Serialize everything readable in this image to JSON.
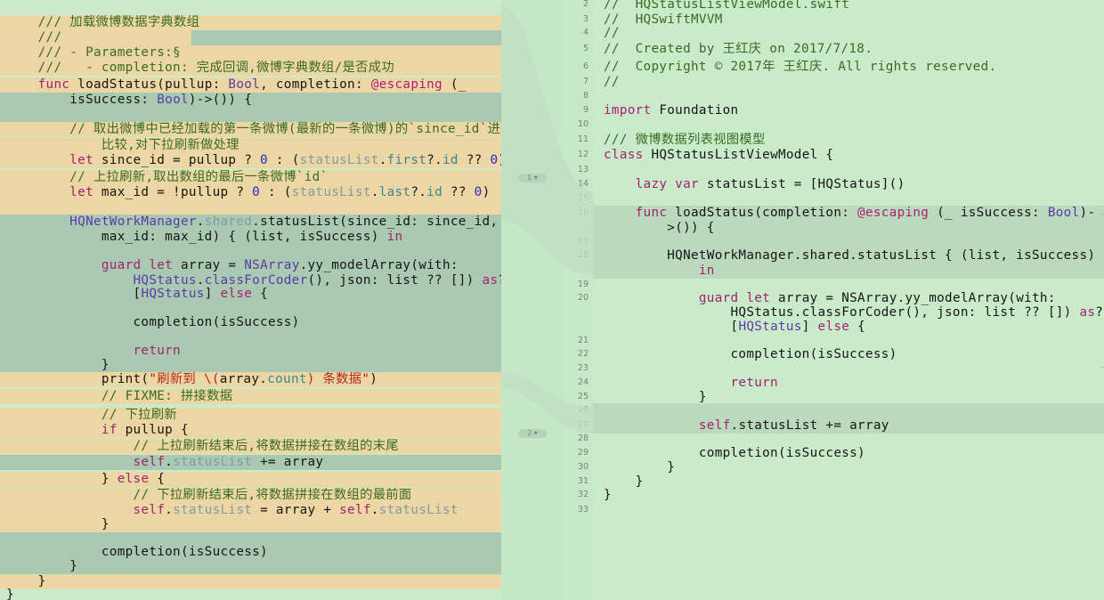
{
  "left_pane": {
    "lines": [
      {
        "bg": "y",
        "tokens": [
          {
            "c": "cm",
            "t": "    /// 加载微博数据字典数组"
          }
        ]
      },
      {
        "bg": "mix",
        "tokens": [
          {
            "c": "cm",
            "t": "    ///"
          }
        ]
      },
      {
        "bg": "y",
        "tokens": [
          {
            "c": "cm",
            "t": "    /// - Parameters:§"
          }
        ]
      },
      {
        "bg": "y",
        "tokens": [
          {
            "c": "cm",
            "t": "    ///   - completion: 完成回调,微博字典数组/是否成功"
          }
        ]
      },
      {
        "bg": "y",
        "tokens": [
          {
            "c": "kw",
            "t": "    func"
          },
          {
            "c": "pl",
            "t": " loadStatus(pullup: "
          },
          {
            "c": "ty",
            "t": "Bool"
          },
          {
            "c": "pl",
            "t": ", completion: "
          },
          {
            "c": "at",
            "t": "@escaping"
          },
          {
            "c": "pl",
            "t": " (_"
          }
        ]
      },
      {
        "bg": "g",
        "tokens": [
          {
            "c": "pl",
            "t": "        isSuccess: "
          },
          {
            "c": "ty",
            "t": "Bool"
          },
          {
            "c": "pl",
            "t": ")->()) {"
          }
        ]
      },
      {
        "bg": "g",
        "tokens": [
          {
            "c": "pl",
            "t": ""
          }
        ]
      },
      {
        "bg": "y",
        "tokens": [
          {
            "c": "cm",
            "t": "        // 取出微博中已经加载的第一条微博(最新的一条微博)的`since_id`进行"
          }
        ]
      },
      {
        "bg": "y",
        "tokens": [
          {
            "c": "cm",
            "t": "            比较,对下拉刷新做处理"
          }
        ]
      },
      {
        "bg": "y",
        "tokens": [
          {
            "c": "kw",
            "t": "        let"
          },
          {
            "c": "pl",
            "t": " since_id = pullup ? "
          },
          {
            "c": "num",
            "t": "0"
          },
          {
            "c": "pl",
            "t": " : ("
          },
          {
            "c": "gty",
            "t": "statusList"
          },
          {
            "c": "pl",
            "t": "."
          },
          {
            "c": "prop",
            "t": "first"
          },
          {
            "c": "pl",
            "t": "?."
          },
          {
            "c": "prop",
            "t": "id"
          },
          {
            "c": "pl",
            "t": " ?? "
          },
          {
            "c": "num",
            "t": "0"
          },
          {
            "c": "pl",
            "t": ")"
          }
        ]
      },
      {
        "bg": "y",
        "tokens": [
          {
            "c": "cm",
            "t": "        // 上拉刷新,取出数组的最后一条微博`id`"
          }
        ]
      },
      {
        "bg": "y",
        "tokens": [
          {
            "c": "kw",
            "t": "        let"
          },
          {
            "c": "pl",
            "t": " max_id = !pullup ? "
          },
          {
            "c": "num",
            "t": "0"
          },
          {
            "c": "pl",
            "t": " : ("
          },
          {
            "c": "gty",
            "t": "statusList"
          },
          {
            "c": "pl",
            "t": "."
          },
          {
            "c": "prop",
            "t": "last"
          },
          {
            "c": "pl",
            "t": "?."
          },
          {
            "c": "prop",
            "t": "id"
          },
          {
            "c": "pl",
            "t": " ?? "
          },
          {
            "c": "num",
            "t": "0"
          },
          {
            "c": "pl",
            "t": ")"
          }
        ]
      },
      {
        "bg": "y",
        "tokens": [
          {
            "c": "pl",
            "t": ""
          }
        ]
      },
      {
        "bg": "g",
        "tokens": [
          {
            "c": "ty",
            "t": "        HQNetWorkManager"
          },
          {
            "c": "pl",
            "t": "."
          },
          {
            "c": "gty",
            "t": "shared"
          },
          {
            "c": "pl",
            "t": ".statusList(since_id: since_id,"
          }
        ]
      },
      {
        "bg": "g",
        "tokens": [
          {
            "c": "pl",
            "t": "            max_id: max_id) { (list, isSuccess) "
          },
          {
            "c": "kw",
            "t": "in"
          }
        ]
      },
      {
        "bg": "g",
        "tokens": [
          {
            "c": "pl",
            "t": ""
          }
        ]
      },
      {
        "bg": "g",
        "tokens": [
          {
            "c": "kw",
            "t": "            guard"
          },
          {
            "c": "kw",
            "t": " let"
          },
          {
            "c": "pl",
            "t": " array = "
          },
          {
            "c": "ty",
            "t": "NSArray"
          },
          {
            "c": "pl",
            "t": ".yy_modelArray(with:"
          }
        ]
      },
      {
        "bg": "g",
        "tokens": [
          {
            "c": "ty",
            "t": "                HQStatus"
          },
          {
            "c": "pl",
            "t": "."
          },
          {
            "c": "ty",
            "t": "classForCoder"
          },
          {
            "c": "pl",
            "t": "(), json: list ?? []) "
          },
          {
            "c": "kw",
            "t": "as"
          },
          {
            "c": "pl",
            "t": "?"
          }
        ]
      },
      {
        "bg": "g",
        "tokens": [
          {
            "c": "pl",
            "t": "                ["
          },
          {
            "c": "ty",
            "t": "HQStatus"
          },
          {
            "c": "pl",
            "t": "] "
          },
          {
            "c": "kw",
            "t": "else"
          },
          {
            "c": "pl",
            "t": " {"
          }
        ]
      },
      {
        "bg": "g",
        "tokens": [
          {
            "c": "pl",
            "t": ""
          }
        ]
      },
      {
        "bg": "g",
        "tokens": [
          {
            "c": "pl",
            "t": "                completion(isSuccess)"
          }
        ]
      },
      {
        "bg": "g",
        "tokens": [
          {
            "c": "pl",
            "t": ""
          }
        ]
      },
      {
        "bg": "g",
        "tokens": [
          {
            "c": "kw",
            "t": "                return"
          }
        ]
      },
      {
        "bg": "g",
        "tokens": [
          {
            "c": "pl",
            "t": "            }"
          }
        ]
      },
      {
        "bg": "y",
        "tokens": [
          {
            "c": "pl",
            "t": "            print("
          },
          {
            "c": "str",
            "t": "\"刷新到 \\("
          },
          {
            "c": "pl",
            "t": "array."
          },
          {
            "c": "prop",
            "t": "count"
          },
          {
            "c": "str",
            "t": ") 条数据\""
          },
          {
            "c": "pl",
            "t": ")"
          }
        ]
      },
      {
        "bg": "y",
        "tokens": [
          {
            "c": "cm",
            "t": "            // FIXME: 拼接数据"
          }
        ]
      },
      {
        "bg": "y",
        "tokens": [
          {
            "c": "cm",
            "t": "            // 下拉刷新"
          }
        ]
      },
      {
        "bg": "y",
        "tokens": [
          {
            "c": "kw",
            "t": "            if"
          },
          {
            "c": "pl",
            "t": " pullup {"
          }
        ]
      },
      {
        "bg": "y",
        "tokens": [
          {
            "c": "cm",
            "t": "                // 上拉刷新结束后,将数据拼接在数组的末尾"
          }
        ]
      },
      {
        "bg": "g",
        "tokens": [
          {
            "c": "kw",
            "t": "                self"
          },
          {
            "c": "pl",
            "t": "."
          },
          {
            "c": "gty",
            "t": "statusList"
          },
          {
            "c": "pl",
            "t": " += array"
          }
        ]
      },
      {
        "bg": "y",
        "tokens": [
          {
            "c": "pl",
            "t": "            } "
          },
          {
            "c": "kw",
            "t": "else"
          },
          {
            "c": "pl",
            "t": " {"
          }
        ]
      },
      {
        "bg": "y",
        "tokens": [
          {
            "c": "cm",
            "t": "                // 下拉刷新结束后,将数据拼接在数组的最前面"
          }
        ]
      },
      {
        "bg": "y",
        "tokens": [
          {
            "c": "kw",
            "t": "                self"
          },
          {
            "c": "pl",
            "t": "."
          },
          {
            "c": "gty",
            "t": "statusList"
          },
          {
            "c": "pl",
            "t": " = array + "
          },
          {
            "c": "kw",
            "t": "self"
          },
          {
            "c": "pl",
            "t": "."
          },
          {
            "c": "gty",
            "t": "statusList"
          }
        ]
      },
      {
        "bg": "y",
        "tokens": [
          {
            "c": "pl",
            "t": "            }"
          }
        ]
      },
      {
        "bg": "g",
        "tokens": [
          {
            "c": "pl",
            "t": ""
          }
        ]
      },
      {
        "bg": "g",
        "tokens": [
          {
            "c": "pl",
            "t": "            completion(isSuccess)"
          }
        ]
      },
      {
        "bg": "g",
        "tokens": [
          {
            "c": "pl",
            "t": "        }"
          }
        ]
      },
      {
        "bg": "y",
        "tokens": [
          {
            "c": "pl",
            "t": "    }"
          }
        ]
      },
      {
        "bg": "none",
        "tokens": [
          {
            "c": "pl",
            "t": "}"
          }
        ]
      }
    ]
  },
  "change_markers": [
    {
      "label": "1"
    },
    {
      "label": "2"
    }
  ],
  "right_pane": {
    "lines": [
      {
        "n": "2",
        "bg": "none",
        "tokens": [
          {
            "c": "cm",
            "t": "//  HQStatusListViewModel.swift"
          }
        ]
      },
      {
        "n": "3",
        "bg": "none",
        "tokens": [
          {
            "c": "cm",
            "t": "//  HQSwiftMVVM"
          }
        ]
      },
      {
        "n": "4",
        "bg": "none",
        "tokens": [
          {
            "c": "cm",
            "t": "//"
          }
        ]
      },
      {
        "n": "5",
        "bg": "none",
        "tokens": [
          {
            "c": "cm",
            "t": "//  Created by 王红庆 on 2017/7/18."
          }
        ]
      },
      {
        "n": "6",
        "bg": "none",
        "tokens": [
          {
            "c": "cm",
            "t": "//  Copyright © 2017年 王红庆. All rights reserved."
          }
        ]
      },
      {
        "n": "7",
        "bg": "none",
        "tokens": [
          {
            "c": "cm",
            "t": "//"
          }
        ]
      },
      {
        "n": "8",
        "bg": "none",
        "tokens": [
          {
            "c": "pl",
            "t": ""
          }
        ]
      },
      {
        "n": "9",
        "bg": "none",
        "tokens": [
          {
            "c": "kw",
            "t": "import"
          },
          {
            "c": "pl",
            "t": " Foundation"
          }
        ]
      },
      {
        "n": "10",
        "bg": "none",
        "tokens": [
          {
            "c": "pl",
            "t": ""
          }
        ]
      },
      {
        "n": "11",
        "bg": "none",
        "tokens": [
          {
            "c": "cm",
            "t": "/// 微博数据列表视图模型"
          }
        ]
      },
      {
        "n": "12",
        "bg": "none",
        "tokens": [
          {
            "c": "kw",
            "t": "class"
          },
          {
            "c": "pl",
            "t": " HQStatusListViewModel {"
          }
        ]
      },
      {
        "n": "13",
        "bg": "none",
        "tokens": [
          {
            "c": "pl",
            "t": ""
          }
        ]
      },
      {
        "n": "14",
        "bg": "none",
        "tokens": [
          {
            "c": "kw",
            "t": "    lazy"
          },
          {
            "c": "kw",
            "t": " var"
          },
          {
            "c": "pl",
            "t": " statusList = [HQStatus]()"
          }
        ]
      },
      {
        "n": "15",
        "bg": "none",
        "tokens": [
          {
            "c": "pl",
            "t": ""
          }
        ]
      },
      {
        "n": "16",
        "bg": "rg",
        "tokens": [
          {
            "c": "kw",
            "t": "    func"
          },
          {
            "c": "pl",
            "t": " loadStatus(completion: "
          },
          {
            "c": "at",
            "t": "@escaping"
          },
          {
            "c": "pl",
            "t": " (_ isSuccess: "
          },
          {
            "c": "ty",
            "t": "Bool"
          },
          {
            "c": "pl",
            "t": ")-"
          }
        ]
      },
      {
        "n": "",
        "bg": "rg",
        "tokens": [
          {
            "c": "pl",
            "t": "        >()) {"
          }
        ]
      },
      {
        "n": "17",
        "bg": "rg",
        "tokens": [
          {
            "c": "pl",
            "t": ""
          }
        ]
      },
      {
        "n": "18",
        "bg": "rg",
        "tokens": [
          {
            "c": "pl",
            "t": "        HQNetWorkManager.shared.statusList { (list, isSuccess)"
          }
        ]
      },
      {
        "n": "",
        "bg": "rg",
        "tokens": [
          {
            "c": "kw",
            "t": "            in"
          }
        ]
      },
      {
        "n": "19",
        "bg": "none",
        "tokens": [
          {
            "c": "pl",
            "t": ""
          }
        ]
      },
      {
        "n": "20",
        "bg": "none",
        "tokens": [
          {
            "c": "kw",
            "t": "            guard"
          },
          {
            "c": "kw",
            "t": " let"
          },
          {
            "c": "pl",
            "t": " array = NSArray.yy_modelArray(with:"
          }
        ]
      },
      {
        "n": "",
        "bg": "none",
        "tokens": [
          {
            "c": "pl",
            "t": "                HQStatus.classForCoder(), json: list ?? []) "
          },
          {
            "c": "kw",
            "t": "as"
          },
          {
            "c": "pl",
            "t": "?"
          }
        ]
      },
      {
        "n": "",
        "bg": "none",
        "tokens": [
          {
            "c": "pl",
            "t": "                ["
          },
          {
            "c": "ty",
            "t": "HQStatus"
          },
          {
            "c": "pl",
            "t": "] "
          },
          {
            "c": "kw",
            "t": "else"
          },
          {
            "c": "pl",
            "t": " {"
          }
        ]
      },
      {
        "n": "21",
        "bg": "none",
        "tokens": [
          {
            "c": "pl",
            "t": ""
          }
        ]
      },
      {
        "n": "22",
        "bg": "none",
        "tokens": [
          {
            "c": "pl",
            "t": "                completion(isSuccess)"
          }
        ]
      },
      {
        "n": "23",
        "bg": "none",
        "tokens": [
          {
            "c": "pl",
            "t": ""
          }
        ]
      },
      {
        "n": "24",
        "bg": "none",
        "tokens": [
          {
            "c": "kw",
            "t": "                return"
          }
        ]
      },
      {
        "n": "25",
        "bg": "none",
        "tokens": [
          {
            "c": "pl",
            "t": "            }"
          }
        ]
      },
      {
        "n": "26",
        "bg": "rg",
        "tokens": [
          {
            "c": "pl",
            "t": ""
          }
        ]
      },
      {
        "n": "27",
        "bg": "rg",
        "tokens": [
          {
            "c": "kw",
            "t": "            self"
          },
          {
            "c": "pl",
            "t": ".statusList += array"
          }
        ]
      },
      {
        "n": "28",
        "bg": "none",
        "tokens": [
          {
            "c": "pl",
            "t": ""
          }
        ]
      },
      {
        "n": "29",
        "bg": "none",
        "tokens": [
          {
            "c": "pl",
            "t": "            completion(isSuccess)"
          }
        ]
      },
      {
        "n": "30",
        "bg": "none",
        "tokens": [
          {
            "c": "pl",
            "t": "        }"
          }
        ]
      },
      {
        "n": "31",
        "bg": "none",
        "tokens": [
          {
            "c": "pl",
            "t": "    }"
          }
        ]
      },
      {
        "n": "32",
        "bg": "none",
        "tokens": [
          {
            "c": "pl",
            "t": "}"
          }
        ]
      },
      {
        "n": "33",
        "bg": "none",
        "tokens": [
          {
            "c": "pl",
            "t": ""
          }
        ]
      }
    ]
  }
}
